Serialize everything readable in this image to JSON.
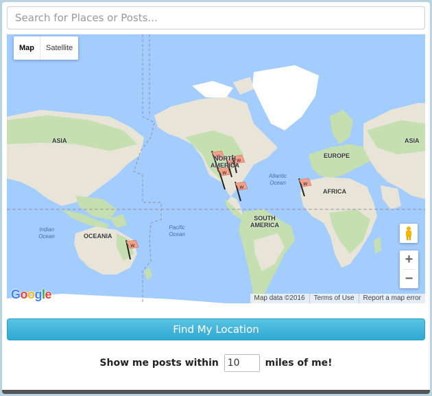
{
  "search": {
    "placeholder": "Search for Places or Posts..."
  },
  "map": {
    "type_controls": {
      "map_label": "Map",
      "satellite_label": "Satellite",
      "selected": "Map"
    },
    "zoom": {
      "in_label": "+",
      "out_label": "−"
    },
    "continent_labels": {
      "asia_left": "ASIA",
      "north_america": "NORTH AMERICA",
      "europe": "EUROPE",
      "asia_right": "ASIA",
      "africa": "AFRICA",
      "south_america": "SOUTH AMERICA",
      "oceania": "OCEANIA"
    },
    "ocean_labels": {
      "indian": "Indian Ocean",
      "pacific": "Pacific Ocean",
      "atlantic": "Atlantic Ocean"
    },
    "logo_text": "Google",
    "attribution": {
      "data": "Map data ©2016",
      "terms": "Terms of Use",
      "report": "Report a map error"
    },
    "marker_count": 7,
    "colors": {
      "water": "#a3ccff",
      "land": "#e8e5d8",
      "vegetation": "#c5dfb1",
      "ice": "#ffffff",
      "marker": "#f6a08c"
    }
  },
  "find_button": {
    "label": "Find My Location"
  },
  "radius": {
    "prefix": "Show me posts within",
    "value": "10",
    "suffix": "miles of me!"
  }
}
